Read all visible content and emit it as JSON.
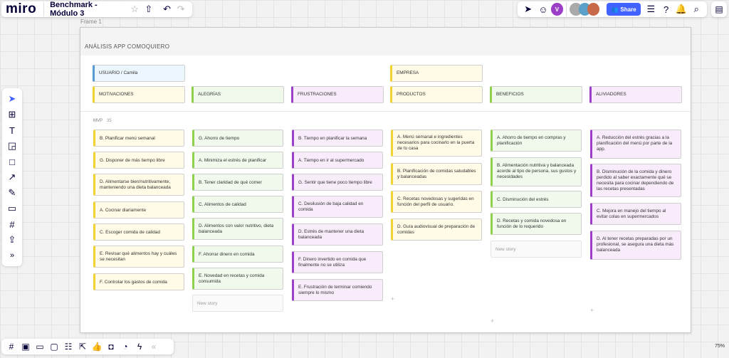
{
  "app": {
    "logo": "miro",
    "board_title": "Benchmark - Módulo 3"
  },
  "toolbar": {
    "share_label": "Share",
    "avatar_initial": "V"
  },
  "frame": {
    "label": "Frame 1",
    "title": "ANÁLISIS APP COMOQUIERO"
  },
  "zoom": "75%",
  "mvp": {
    "label": "MVP",
    "count": "35"
  },
  "colors": {
    "blue": "#5b9bd5",
    "blue_bg": "#ecf6fd",
    "yellow": "#f2d230",
    "yellow_bg": "#fffbe6",
    "green": "#8fd14f",
    "green_bg": "#f1f9ec",
    "purple": "#9c3fc7",
    "purple_bg": "#f8ecfb",
    "accent": "#4262ff"
  },
  "header_cards": {
    "usuario": "USUARIO / Camila",
    "empresa": "EMPRESA",
    "motivaciones": "MOTIVACIONES",
    "alegrias": "ALEGRÍAS",
    "frustraciones": "FRUSTRACIONES",
    "productos": "PRODUCTOS",
    "beneficios": "BENEFICIOS",
    "aliviadores": "ALIVIADORES"
  },
  "motivaciones": [
    "B. Planificar menú semanal",
    "G. Disponer de más tiempo libre",
    "D. Alimentarse bien/nutritivamente, manteniendo una dieta balanceada",
    "A. Cocinar diariamente",
    "C. Escoger comida de calidad",
    "E. Revisar qué alimentos hay y cuáles se necesitan",
    "F. Controlar los gastos de comida"
  ],
  "alegrias": [
    "G. Ahorro de tiempo",
    "A. Minimiza el estrés de planificar",
    "B. Tener claridad de qué comer",
    "C. Alimentos de calidad",
    "D. Alimentos con valor nutritivo, dieta balanceada",
    "F. Ahorrar dinero en comida",
    "E. Novedad en recetas y comida consumida"
  ],
  "frustraciones": [
    "B. Tiempo en planificar la semana",
    "A. Tiempo en ir al supermercado",
    "G. Sentir que tiene poco tiempo libre",
    "C. Desilusión de baja calidad en comida",
    "D. Estrés de mantener una dieta balanceada",
    "F. Dinero invertido en comida que finalmente no se utiliza",
    "E. Frustración de terminar comiendo siempre lo mismo"
  ],
  "productos": [
    "A. Menú semanal e ingredientes necesarios para cocinarlo en la puerta de tu casa",
    "B. Planificación de comidas saludables y balanceadas",
    "C. Recetas novedosas y sugeridas en función del perfil de usuario.",
    "D. Guía audiovisual de preparación de comidas"
  ],
  "beneficios": [
    "A. Ahorro de tiempo en compras y planificación",
    "B. Alimentación nutritiva y balanceada acorde al tipo de persona, sus gustos y necesidades",
    "C. Disminución del estrés",
    "D. Recetas y comida novedosa en función de lo requerido"
  ],
  "aliviadores": [
    "A. Reducción del estrés gracias a la planificación del menú por parte de la app.",
    "B. Disminución de la comida y dinero perdido al saber exactamente qué se necesita para cocinar dependiendo de las recetas presentadas",
    "C. Mejora en manejo del tiempo al evitar colas en supermercados",
    "D. Al tener recetas preparadas por un profesional, se asegura una dieta más balanceada"
  ],
  "new_story": "New story",
  "plus": "+"
}
